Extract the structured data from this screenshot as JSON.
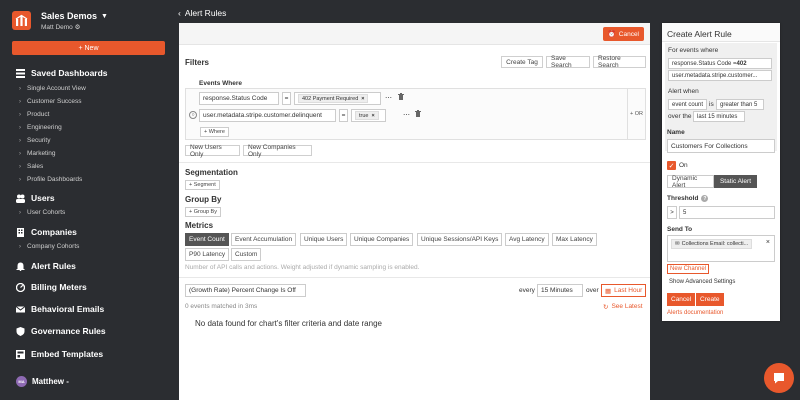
{
  "sidebar": {
    "org_name": "Sales Demos",
    "user_name": "Matt Demo",
    "new_label": "+ New",
    "saved_dashboards": "Saved Dashboards",
    "dashboards": [
      "Single Account View",
      "Customer Success",
      "Product",
      "Engineering",
      "Security",
      "Marketing",
      "Sales",
      "Profile Dashboards"
    ],
    "users": "Users",
    "user_cohorts": "User Cohorts",
    "companies": "Companies",
    "company_cohorts": "Company Cohorts",
    "alert_rules": "Alert Rules",
    "billing_meters": "Billing Meters",
    "behavioral_emails": "Behavioral Emails",
    "governance_rules": "Governance Rules",
    "embed_templates": "Embed Templates",
    "footer_user": "Matthew -",
    "footer_initials": "MA"
  },
  "header": {
    "back_label": "Alert Rules",
    "cancel_label": "Cancel"
  },
  "filters": {
    "title": "Filters",
    "create_tag": "Create Tag",
    "save_search": "Save Search",
    "restore_search": "Restore Search",
    "events_where": "Events Where",
    "row1_field": "response.Status Code",
    "row1_op": "=",
    "row1_value": "402 Payment Required",
    "row2_field": "user.metadata.stripe.customer.delinquent",
    "row2_op": "=",
    "row2_value": "true",
    "add_where": "+ Where",
    "or_label": "+ OR",
    "new_users_only": "New Users Only",
    "new_companies_only": "New Companies Only"
  },
  "segmentation": {
    "title": "Segmentation",
    "add": "+ Segment"
  },
  "group_by": {
    "title": "Group By",
    "add": "+ Group By"
  },
  "metrics": {
    "title": "Metrics",
    "row1": [
      "Event Count",
      "Event Accumulation",
      "Unique Users",
      "Unique Companies",
      "Unique Sessions/API Keys",
      "Avg Latency",
      "Max Latency"
    ],
    "row2": [
      "P90 Latency",
      "Custom"
    ],
    "active": "Event Count",
    "hint": "Number of API calls and actions. Weight adjusted if dynamic sampling is enabled."
  },
  "chart": {
    "mode": "(Growth Rate) Percent Change Is Off",
    "every_label": "every",
    "interval": "15 Minutes",
    "over_label": "over",
    "range": "Last Hour",
    "matched": "0 events matched in 3ms",
    "see_latest": "See Latest",
    "empty": "No data found for chart's filter criteria and date range"
  },
  "alert": {
    "title": "Create Alert Rule",
    "for_events_where": "For events where",
    "cond1_prefix": "response.Status Code = ",
    "cond1_value": "402",
    "cond2": "user.metadata.stripe.customer...",
    "alert_when": "Alert when",
    "event_count": "event count",
    "is": "is",
    "greater_than": "greater than 5",
    "over_the": "over the",
    "last_15": "last 15 minutes",
    "name_label": "Name",
    "name_value": "Customers For Collections",
    "on_label": "On",
    "dynamic": "Dynamic Alert",
    "static": "Static Alert",
    "threshold_label": "Threshold",
    "threshold_op": ">",
    "threshold_value": "5",
    "send_to": "Send To",
    "channel": "Collections Email: collecti...",
    "new_channel": "New Channel",
    "show_advanced": "Show Advanced Settings",
    "cancel": "Cancel",
    "create": "Create",
    "docs": "Alerts documentation"
  },
  "colors": {
    "accent": "#e8582c",
    "sidebar_bg": "#2b2d31",
    "active_metric": "#555555"
  }
}
